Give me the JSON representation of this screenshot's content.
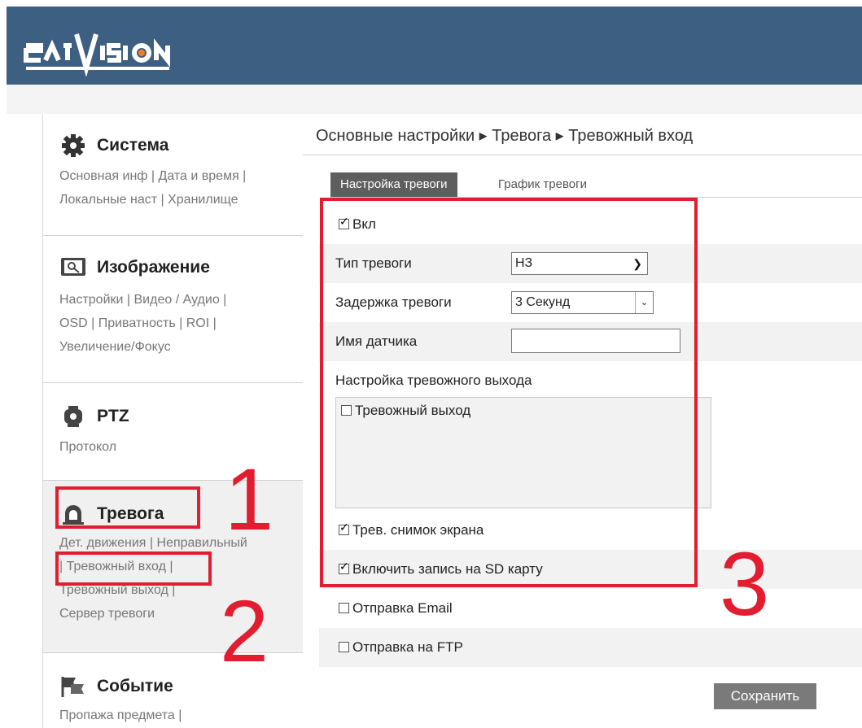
{
  "header": {
    "logo_text": "SATVISION",
    "bg_color": "#3d5f82"
  },
  "breadcrumb": "Основные настройки ▸ Тревога ▸ Тревожный вход",
  "sidebar": {
    "groups": [
      {
        "title": "Система",
        "icon": "gear-icon",
        "links": [
          "Основная инф | Дата и время |",
          "Локальные наст | Хранилище"
        ]
      },
      {
        "title": "Изображение",
        "icon": "image-icon",
        "links": [
          "Настройки | Видео / Аудио |",
          "OSD | Приватность | ROI |",
          "Увеличение/Фокус"
        ]
      },
      {
        "title": "PTZ",
        "icon": "ptz-camera-icon",
        "links": [
          "Протокол"
        ]
      },
      {
        "title": "Тревога",
        "icon": "alarm-bell-icon",
        "links": [
          "Дет. движения | Неправильный",
          "| Тревожный вход |",
          "Тревожный выход |",
          "Сервер тревоги"
        ]
      },
      {
        "title": "Событие",
        "icon": "event-flag-icon",
        "links": [
          "Пропажа предмета |"
        ]
      }
    ]
  },
  "tabs": [
    {
      "label": "Настройка тревоги",
      "active": true
    },
    {
      "label": "График тревоги",
      "active": false
    }
  ],
  "form": {
    "enable_label": "Вкл",
    "enable_checked": true,
    "alarm_type_label": "Тип тревоги",
    "alarm_type_value": "НЗ",
    "alarm_delay_label": "Задержка тревоги",
    "alarm_delay_value": "3 Секунд",
    "sensor_name_label": "Имя датчика",
    "sensor_name_value": "",
    "alarm_output_settings_label": "Настройка тревожного выхода",
    "alarm_output_label": "Тревожный выход",
    "alarm_output_checked": false,
    "snapshot_label": "Трев. снимок экрана",
    "snapshot_checked": true,
    "sd_record_label": "Включить запись на SD карту",
    "sd_record_checked": true,
    "email_label": "Отправка Email",
    "email_checked": false,
    "ftp_label": "Отправка на FTP",
    "ftp_checked": false
  },
  "save_label": "Сохранить",
  "annotations": {
    "one": "1",
    "two": "2",
    "three": "3",
    "color": "#e21d2f"
  }
}
